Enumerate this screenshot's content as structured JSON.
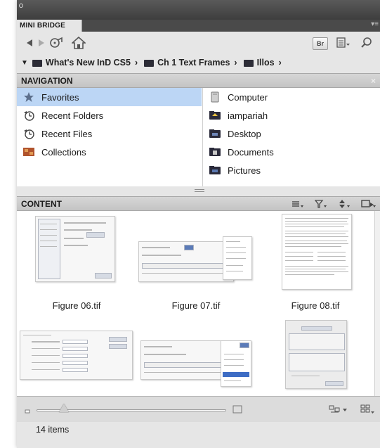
{
  "panel": {
    "tab_title": "MINI BRIDGE",
    "br_label": "Br"
  },
  "breadcrumb": [
    {
      "label": "What's New InD CS5"
    },
    {
      "label": "Ch 1 Text Frames"
    },
    {
      "label": "Illos"
    }
  ],
  "navigation": {
    "title": "NAVIGATION",
    "left_items": [
      {
        "label": "Favorites",
        "icon": "star-icon",
        "selected": true
      },
      {
        "label": "Recent Folders",
        "icon": "recent-folders-icon"
      },
      {
        "label": "Recent Files",
        "icon": "recent-files-icon"
      },
      {
        "label": "Collections",
        "icon": "collections-icon"
      }
    ],
    "right_items": [
      {
        "label": "Computer",
        "icon": "computer-icon"
      },
      {
        "label": "iampariah",
        "icon": "home-folder-icon"
      },
      {
        "label": "Desktop",
        "icon": "desktop-folder-icon"
      },
      {
        "label": "Documents",
        "icon": "documents-folder-icon"
      },
      {
        "label": "Pictures",
        "icon": "pictures-folder-icon"
      }
    ]
  },
  "content": {
    "title": "CONTENT",
    "items": [
      {
        "caption": "Figure 06.tif"
      },
      {
        "caption": "Figure 07.tif"
      },
      {
        "caption": "Figure 08.tif"
      },
      {
        "caption": ""
      },
      {
        "caption": ""
      },
      {
        "caption": ""
      }
    ]
  },
  "status": {
    "item_count": "14 items"
  },
  "colors": {
    "selection": "#bcd6f5",
    "header_dark": "#4a4a4a",
    "panel_bg": "#e6e6e6"
  }
}
